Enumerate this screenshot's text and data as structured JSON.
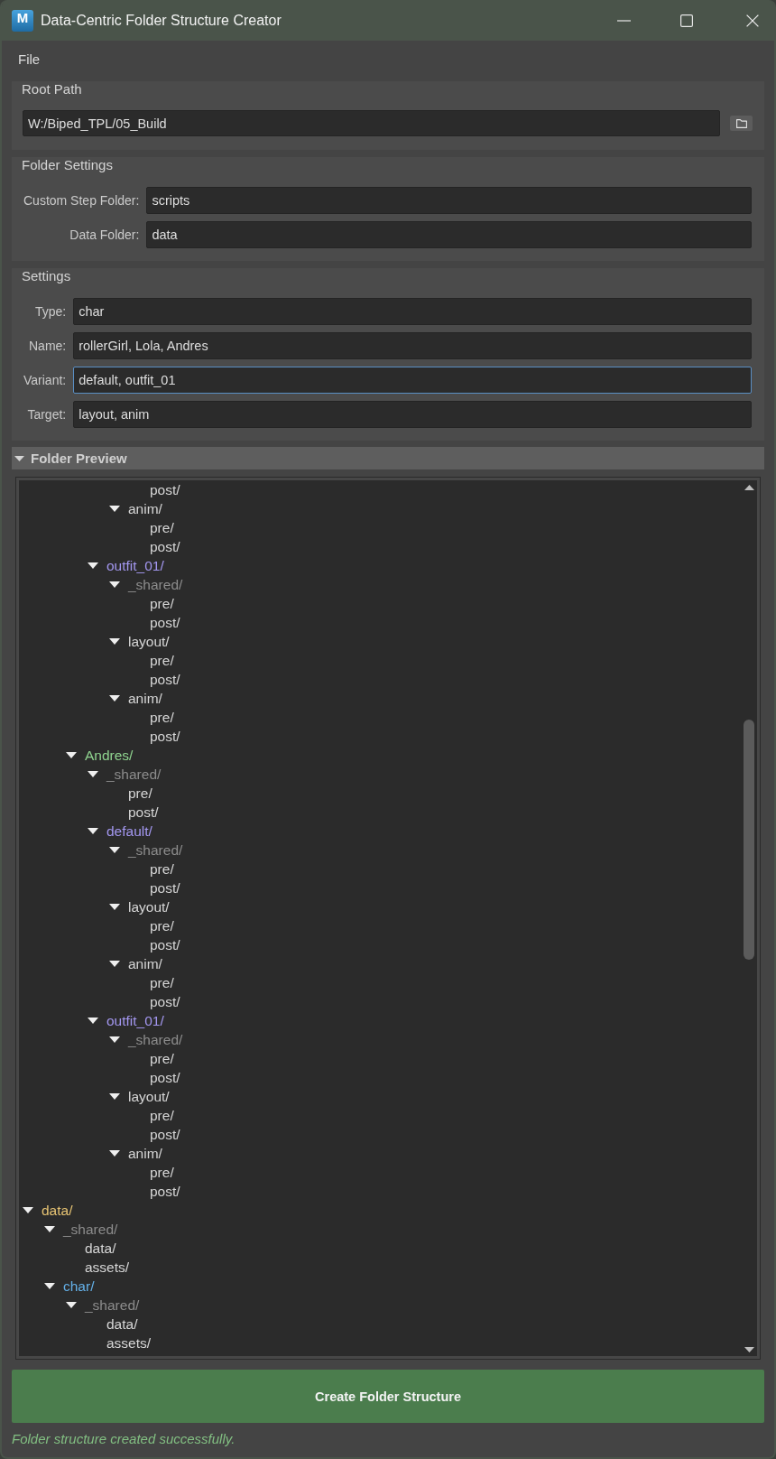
{
  "window": {
    "title": "Data-Centric Folder Structure Creator",
    "logo": "M"
  },
  "menu_bar": [
    "File"
  ],
  "root_path": {
    "title": "Root Path",
    "field": {
      "value": "W:/Biped_TPL/05_Build",
      "focused": false
    }
  },
  "folder_settings": {
    "title": "Folder Settings",
    "fields": [
      {
        "label": "Custom Step Folder:",
        "value": "scripts",
        "focused": false
      },
      {
        "label": "Data Folder:",
        "value": "data",
        "focused": false
      }
    ]
  },
  "settings": {
    "title": "Settings",
    "fields": [
      {
        "label": "Type:",
        "value": "char",
        "focused": false
      },
      {
        "label": "Name:",
        "value": "rollerGirl, Lola, Andres",
        "focused": false
      },
      {
        "label": "Variant:",
        "value": "default, outfit_01",
        "focused": true
      },
      {
        "label": "Target:",
        "value": "layout, anim",
        "focused": false
      }
    ]
  },
  "folder_preview": {
    "title": "Folder Preview",
    "expanded": true,
    "tree": [
      {
        "children": [
          {
            "children": [
              {
                "children": [
                  {
                    "children": [
                      {
                        "children": [
                          {
                            "label": "post/",
                            "color": "#d6d6d6"
                          }
                        ]
                      },
                      {
                        "label": "anim/",
                        "color": "#d6d6d6",
                        "expanded": true,
                        "children": [
                          {
                            "label": "pre/",
                            "color": "#d6d6d6"
                          },
                          {
                            "label": "post/",
                            "color": "#d6d6d6"
                          }
                        ]
                      }
                    ]
                  },
                  {
                    "label": "outfit_01/",
                    "color": "#a397f0",
                    "expanded": true,
                    "children": [
                      {
                        "label": "_shared/",
                        "color": "#8c8c8c",
                        "expanded": true,
                        "children": [
                          {
                            "label": "pre/",
                            "color": "#d6d6d6"
                          },
                          {
                            "label": "post/",
                            "color": "#d6d6d6"
                          }
                        ]
                      },
                      {
                        "label": "layout/",
                        "color": "#d6d6d6",
                        "expanded": true,
                        "children": [
                          {
                            "label": "pre/",
                            "color": "#d6d6d6"
                          },
                          {
                            "label": "post/",
                            "color": "#d6d6d6"
                          }
                        ]
                      },
                      {
                        "label": "anim/",
                        "color": "#d6d6d6",
                        "expanded": true,
                        "children": [
                          {
                            "label": "pre/",
                            "color": "#d6d6d6"
                          },
                          {
                            "label": "post/",
                            "color": "#d6d6d6"
                          }
                        ]
                      }
                    ]
                  }
                ]
              },
              {
                "label": "Andres/",
                "color": "#8fd38f",
                "expanded": true,
                "children": [
                  {
                    "label": "_shared/",
                    "color": "#8c8c8c",
                    "expanded": true,
                    "children": [
                      {
                        "label": "pre/",
                        "color": "#d6d6d6"
                      },
                      {
                        "label": "post/",
                        "color": "#d6d6d6"
                      }
                    ]
                  },
                  {
                    "label": "default/",
                    "color": "#a397f0",
                    "expanded": true,
                    "children": [
                      {
                        "label": "_shared/",
                        "color": "#8c8c8c",
                        "expanded": true,
                        "children": [
                          {
                            "label": "pre/",
                            "color": "#d6d6d6"
                          },
                          {
                            "label": "post/",
                            "color": "#d6d6d6"
                          }
                        ]
                      },
                      {
                        "label": "layout/",
                        "color": "#d6d6d6",
                        "expanded": true,
                        "children": [
                          {
                            "label": "pre/",
                            "color": "#d6d6d6"
                          },
                          {
                            "label": "post/",
                            "color": "#d6d6d6"
                          }
                        ]
                      },
                      {
                        "label": "anim/",
                        "color": "#d6d6d6",
                        "expanded": true,
                        "children": [
                          {
                            "label": "pre/",
                            "color": "#d6d6d6"
                          },
                          {
                            "label": "post/",
                            "color": "#d6d6d6"
                          }
                        ]
                      }
                    ]
                  },
                  {
                    "label": "outfit_01/",
                    "color": "#a397f0",
                    "expanded": true,
                    "children": [
                      {
                        "label": "_shared/",
                        "color": "#8c8c8c",
                        "expanded": true,
                        "children": [
                          {
                            "label": "pre/",
                            "color": "#d6d6d6"
                          },
                          {
                            "label": "post/",
                            "color": "#d6d6d6"
                          }
                        ]
                      },
                      {
                        "label": "layout/",
                        "color": "#d6d6d6",
                        "expanded": true,
                        "children": [
                          {
                            "label": "pre/",
                            "color": "#d6d6d6"
                          },
                          {
                            "label": "post/",
                            "color": "#d6d6d6"
                          }
                        ]
                      },
                      {
                        "label": "anim/",
                        "color": "#d6d6d6",
                        "expanded": true,
                        "children": [
                          {
                            "label": "pre/",
                            "color": "#d6d6d6"
                          },
                          {
                            "label": "post/",
                            "color": "#d6d6d6"
                          }
                        ]
                      }
                    ]
                  }
                ]
              }
            ]
          }
        ]
      },
      {
        "label": "data/",
        "color": "#e6c373",
        "expanded": true,
        "children": [
          {
            "label": "_shared/",
            "color": "#8c8c8c",
            "expanded": true,
            "children": [
              {
                "label": "data/",
                "color": "#d6d6d6"
              },
              {
                "label": "assets/",
                "color": "#d6d6d6"
              }
            ]
          },
          {
            "label": "char/",
            "color": "#64b0e8",
            "expanded": true,
            "children": [
              {
                "label": "_shared/",
                "color": "#8c8c8c",
                "expanded": true,
                "children": [
                  {
                    "label": "data/",
                    "color": "#d6d6d6"
                  },
                  {
                    "label": "assets/",
                    "color": "#d6d6d6"
                  }
                ]
              }
            ]
          }
        ]
      }
    ]
  },
  "create_button": {
    "label": "Create Folder Structure"
  },
  "status": {
    "message": "Folder structure created successfully."
  }
}
